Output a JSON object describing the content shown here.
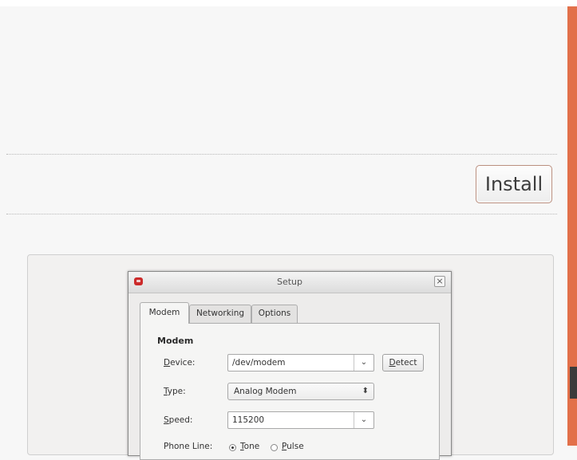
{
  "install_button": {
    "label": "Install"
  },
  "dialog": {
    "title": "Setup",
    "close_glyph": "×",
    "tabs": [
      {
        "label": "Modem",
        "active": true
      },
      {
        "label": "Networking",
        "active": false
      },
      {
        "label": "Options",
        "active": false
      }
    ],
    "section_title": "Modem",
    "device": {
      "label_access": "D",
      "label_rest": "evice:",
      "value": "/dev/modem",
      "arrow": "⌄"
    },
    "detect_button": {
      "access": "D",
      "rest": "etect"
    },
    "type": {
      "label_access": "T",
      "label_rest": "ype:",
      "value": "Analog Modem",
      "arrow": "⬍"
    },
    "speed": {
      "label_access": "S",
      "label_rest": "peed:",
      "value": "115200",
      "arrow": "⌄"
    },
    "phone_line": {
      "label": "Phone Line:",
      "options": [
        {
          "access": "T",
          "rest": "one",
          "selected": true
        },
        {
          "access": "P",
          "rest": "ulse",
          "selected": false
        }
      ]
    }
  },
  "colors": {
    "accent_edge": "#e2704a",
    "install_border": "#b98e7e",
    "app_icon": "#cc2a2a"
  },
  "icons": {
    "app": "setup-app-icon",
    "close": "close-icon"
  }
}
